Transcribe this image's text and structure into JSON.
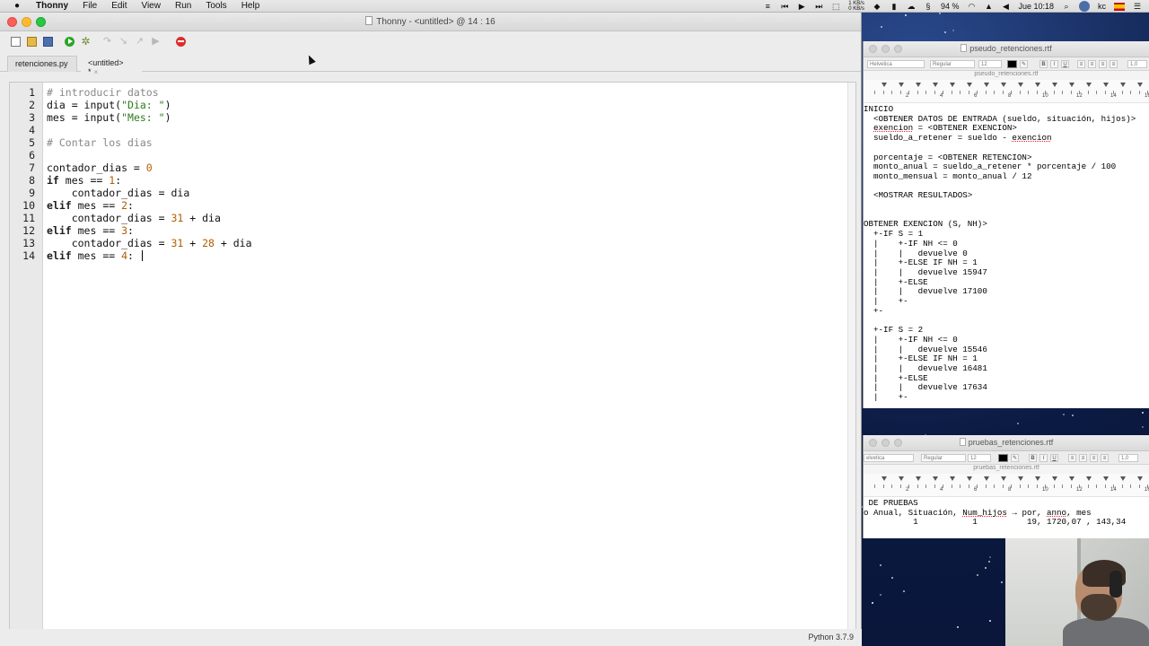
{
  "menubar": {
    "app_name": "Thonny",
    "items": [
      "File",
      "Edit",
      "View",
      "Run",
      "Tools",
      "Help"
    ],
    "net_up": "1 KB/s",
    "net_down": "0 KB/s",
    "battery": "94 %",
    "clock": "Jue 10:18",
    "user": "kc"
  },
  "window": {
    "title": "Thonny  -  <untitled>  @  14 : 16"
  },
  "toolbar": {
    "icons": [
      "new-file-icon",
      "open-file-icon",
      "save-icon",
      "run-icon",
      "debug-icon",
      "step-over-icon",
      "step-into-icon",
      "step-out-icon",
      "resume-icon",
      "stop-icon"
    ]
  },
  "tabs": [
    {
      "label": "retenciones.py"
    },
    {
      "label": "<untitled> *",
      "close": "×"
    }
  ],
  "editor": {
    "line_numbers": [
      "1",
      "2",
      "3",
      "4",
      "5",
      "6",
      "7",
      "8",
      "9",
      "10",
      "11",
      "12",
      "13",
      "14"
    ],
    "lines": [
      "# introducir datos",
      "dia = input(\"Dia: \")",
      "mes = input(\"Mes: \")",
      "",
      "# Contar los dias",
      "",
      "contador_dias = 0",
      "if mes == 1:",
      "    contador_dias = dia",
      "elif mes == 2:",
      "    contador_dias = 31 + dia",
      "elif mes == 3:",
      "    contador_dias = 31 + 28 + dia",
      "elif mes == 4: "
    ]
  },
  "statusbar": {
    "python_version": "Python 3.7.9"
  },
  "pseudo_window": {
    "title": "pseudo_retenciones.rtf",
    "subtitle": "pseudo_retenciones.rtf",
    "font": "Helvetica",
    "style": "Regular",
    "size": "12",
    "spacing": "1,0",
    "ruler": [
      "2",
      "4",
      "6",
      "8",
      "10",
      "12",
      "14",
      "16"
    ],
    "lines": [
      "INICIO",
      "  <OBTENER DATOS DE ENTRADA (sueldo, situación, hijos)>",
      "  exencion = <OBTENER EXENCION>",
      "  sueldo_a_retener = sueldo - exencion",
      "",
      "  porcentaje = <OBTENER RETENCION>",
      "  monto_anual = sueldo_a_retener * porcentaje / 100",
      "  monto_mensual = monto_anual / 12",
      "",
      "  <MOSTRAR RESULTADOS>",
      "",
      "",
      "OBTENER EXENCION (S, NH)>",
      "  +-IF S = 1",
      "  |    +-IF NH <= 0",
      "  |    |   devuelve 0",
      "  |    +-ELSE IF NH = 1",
      "  |    |   devuelve 15947",
      "  |    +-ELSE",
      "  |    |   devuelve 17100",
      "  |    +-",
      "  +-",
      "",
      "  +-IF S = 2",
      "  |    +-IF NH <= 0",
      "  |    |   devuelve 15546",
      "  |    +-ELSE IF NH = 1",
      "  |    |   devuelve 16481",
      "  |    +-ELSE",
      "  |    |   devuelve 17634",
      "  |    +-"
    ]
  },
  "pruebas_window": {
    "title": "pruebas_retenciones.rtf",
    "subtitle": "pruebas_retenciones.rtf",
    "font": "elvetica",
    "style": "Regular",
    "size": "12",
    "spacing": "1,0",
    "ruler": [
      "2",
      "4",
      "6",
      "8",
      "10",
      "12",
      "14",
      "16"
    ],
    "lines": [
      " DE PRUEBAS",
      "o Anual, Situación, Num_hijos → por, anno, mes",
      "          1           1          19, 1720,07 , 143,34"
    ]
  },
  "colors": {
    "keyword": "#1d1d1d",
    "string": "#2e7a1e",
    "number": "#b25d00",
    "comment": "#888888",
    "close_button": "#fc5f57",
    "minimize_button": "#fdbc2e",
    "zoom_button": "#28c840",
    "desktop": "#0e1f4a"
  }
}
